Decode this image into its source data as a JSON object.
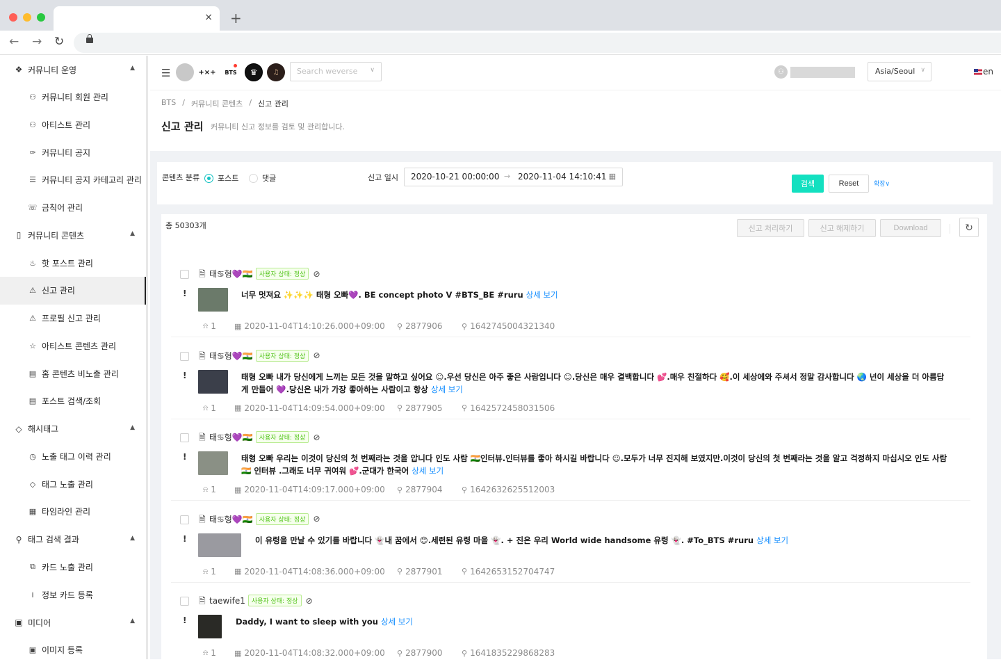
{
  "browser": {
    "close_tab": "×",
    "new_tab": "+",
    "back": "←",
    "forward": "→",
    "reload": "↻"
  },
  "sidebar": {
    "groups": [
      {
        "label": "커뮤니티 운영",
        "icon": "wechat-icon",
        "items": [
          {
            "label": "커뮤니티 회원 관리",
            "icon": "user-icon"
          },
          {
            "label": "아티스트 관리",
            "icon": "user-icon"
          },
          {
            "label": "커뮤니티 공지",
            "icon": "pin-icon"
          },
          {
            "label": "커뮤니티 공지 카테고리 관리",
            "icon": "list-icon"
          },
          {
            "label": "금칙어 관리",
            "icon": "message-icon"
          }
        ]
      },
      {
        "label": "커뮤니티 콘텐츠",
        "icon": "book-icon",
        "items": [
          {
            "label": "핫 포스트 관리",
            "icon": "fire-icon"
          },
          {
            "label": "신고 관리",
            "icon": "warning-icon",
            "active": true
          },
          {
            "label": "프로필 신고 관리",
            "icon": "warning-icon"
          },
          {
            "label": "아티스트 콘텐츠 관리",
            "icon": "star-icon"
          },
          {
            "label": "홈 콘텐츠 비노출 관리",
            "icon": "file-search-icon"
          },
          {
            "label": "포스트 검색/조회",
            "icon": "file-search-icon"
          }
        ]
      },
      {
        "label": "해시태그",
        "icon": "tag-icon",
        "items": [
          {
            "label": "노출 태그 이력 관리",
            "icon": "history-icon"
          },
          {
            "label": "태그 노출 관리",
            "icon": "tag-icon"
          },
          {
            "label": "타임라인 관리",
            "icon": "calendar-icon"
          }
        ]
      },
      {
        "label": "태그 검색 결과",
        "icon": "search-icon",
        "items": [
          {
            "label": "카드 노출 관리",
            "icon": "block-icon"
          },
          {
            "label": "정보 카드 등록",
            "icon": "info-icon"
          }
        ]
      },
      {
        "label": "미디어",
        "icon": "picture-icon",
        "items": [
          {
            "label": "이미지 등록",
            "icon": "picture-icon"
          }
        ]
      }
    ]
  },
  "header": {
    "communities": [
      "",
      "+×+",
      "BTS",
      "♛",
      "♫"
    ],
    "search_placeholder": "Search weverse",
    "timezone": "Asia/Seoul",
    "language": "en"
  },
  "page": {
    "breadcrumb": [
      "BTS",
      "/",
      "커뮤니티 콘텐츠",
      "/",
      "신고 관리"
    ],
    "title": "신고 관리",
    "description": "커뮤니티 신고 정보를 검토 및 관리합니다."
  },
  "filter": {
    "content_type_label": "콘텐츠 분류",
    "options": [
      "포스트",
      "댓글"
    ],
    "selected": "포스트",
    "date_label": "신고 일시",
    "date_from": "2020-10-21 00:00:00",
    "date_to": "2020-11-04 14:10:41",
    "search_button": "검색",
    "reset_button": "Reset",
    "expand_button": "확장∨"
  },
  "list": {
    "total": "총 50303개",
    "actions": [
      "신고 처리하기",
      "신고 해제하기",
      "Download"
    ],
    "status_badge": "사용자 상태: 정상",
    "detail_link": "상세 보기",
    "rows": [
      {
        "author": "태♋형💜🇮🇳",
        "text": "너무 멋져요 ✨✨✨ 태형 오빠💜. BE concept photo V #BTS_BE #ruru",
        "report_count": "1",
        "datetime": "2020-11-04T14:10:26.000+09:00",
        "post_id": "2877906",
        "user_id": "1642745004321340",
        "thumb_color": "#6b7a6a"
      },
      {
        "author": "태♋형💜🇮🇳",
        "text": "태형 오빠 내가 당신에게 느끼는 모든 것을 말하고 싶어요 ☺.우선 당신은 아주 좋은 사람입니다 ☺.당신은 매우 결백합니다 💕.매우 친절하다 🥰.이 세상에와 주셔서 정말 감사합니다 🌏 넌이 세상을 더 아름답게 만들어 💜.당신은 내가 가장 좋아하는 사람이고 항상",
        "report_count": "1",
        "datetime": "2020-11-04T14:09:54.000+09:00",
        "post_id": "2877905",
        "user_id": "1642572458031506",
        "thumb_color": "#3b3f4a"
      },
      {
        "author": "태♋형💜🇮🇳",
        "text": "태형 오빠 우리는 이것이 당신의 첫 번째라는 것을 압니다 인도 사람 🇮🇳인터뷰.인터뷰를 좋아 하시길 바랍니다 ☺.모두가 너무 진지해 보였지만.이것이 당신의 첫 번째라는 것을 알고 걱정하지 마십시오 인도 사람 🇮🇳 인터뷰 .그래도 너무 귀여워 💕.군대가 한국어",
        "report_count": "1",
        "datetime": "2020-11-04T14:09:17.000+09:00",
        "post_id": "2877904",
        "user_id": "1642632625512003",
        "thumb_color": "#8a9085"
      },
      {
        "author": "태♋형💜🇮🇳",
        "text": "이 유령을 만날 수 있기를 바랍니다 👻내 꿈에서 😊.세련된 유령 마을 👻. + 진은 우리 World wide handsome 유령 👻. #To_BTS #ruru",
        "report_count": "1",
        "datetime": "2020-11-04T14:08:36.000+09:00",
        "post_id": "2877901",
        "user_id": "1642653152704747",
        "thumb_color": "#9a9aa0"
      },
      {
        "author": "taewife1",
        "text": "Daddy, I want to sleep with you",
        "report_count": "1",
        "datetime": "2020-11-04T14:08:32.000+09:00",
        "post_id": "2877900",
        "user_id": "1641835229868283",
        "thumb_color": "#2a2a26"
      }
    ]
  },
  "colors": {
    "accent": "#13e0c0",
    "link": "#1890ff",
    "badge_green": "#52c41a"
  }
}
